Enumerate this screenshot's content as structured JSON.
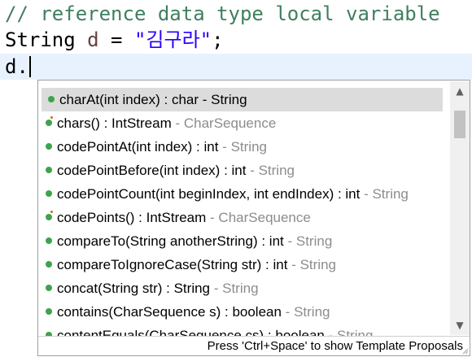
{
  "editor": {
    "comment": "// reference data type local variable",
    "decl_type": "String",
    "decl_var": "d",
    "decl_eq": " = ",
    "decl_string": "\"김구라\"",
    "decl_end": ";",
    "current_line": "d."
  },
  "popup": {
    "items": [
      {
        "sig": "charAt(int index) : char",
        "sep": " - ",
        "decl": "String",
        "icon": "public-method-icon",
        "selected": true
      },
      {
        "sig": "chars() : IntStream",
        "sep": " - ",
        "decl": "CharSequence",
        "icon": "default-method-icon"
      },
      {
        "sig": "codePointAt(int index) : int",
        "sep": " - ",
        "decl": "String",
        "icon": "public-method-icon"
      },
      {
        "sig": "codePointBefore(int index) : int",
        "sep": " - ",
        "decl": "String",
        "icon": "public-method-icon"
      },
      {
        "sig": "codePointCount(int beginIndex, int endIndex) : int",
        "sep": " - ",
        "decl": "String",
        "icon": "public-method-icon"
      },
      {
        "sig": "codePoints() : IntStream",
        "sep": " - ",
        "decl": "CharSequence",
        "icon": "default-method-icon"
      },
      {
        "sig": "compareTo(String anotherString) : int",
        "sep": " - ",
        "decl": "String",
        "icon": "public-method-icon"
      },
      {
        "sig": "compareToIgnoreCase(String str) : int",
        "sep": " - ",
        "decl": "String",
        "icon": "public-method-icon"
      },
      {
        "sig": "concat(String str) : String",
        "sep": " - ",
        "decl": "String",
        "icon": "public-method-icon"
      },
      {
        "sig": "contains(CharSequence s) : boolean",
        "sep": " - ",
        "decl": "String",
        "icon": "public-method-icon"
      },
      {
        "sig": "contentEquals(CharSequence cs) : boolean",
        "sep": " - ",
        "decl": "String",
        "icon": "public-method-icon"
      }
    ],
    "status": "Press 'Ctrl+Space' to show Template Proposals",
    "scroll_up_icon": "scroll-up-arrow-icon",
    "scroll_down_icon": "scroll-down-arrow-icon"
  },
  "colors": {
    "comment": "#3f7f5f",
    "variable": "#6a3e3e",
    "string": "#2a00ff",
    "method_icon": "#3fa34d",
    "current_line_bg": "#e8f2fe",
    "selection_bg": "#dcdcdc"
  }
}
